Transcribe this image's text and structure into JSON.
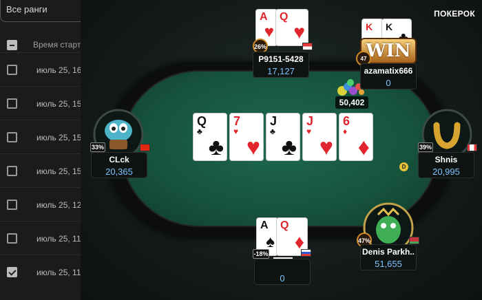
{
  "background_list": {
    "filter_value": "Все ранги",
    "header_label": "Время старт",
    "rows": [
      {
        "text": "июль 25, 16",
        "checked": false
      },
      {
        "text": "июль 25, 15",
        "checked": false
      },
      {
        "text": "июль 25, 15",
        "checked": false
      },
      {
        "text": "июль 25, 15",
        "checked": false
      },
      {
        "text": "июль 25, 12",
        "checked": false
      },
      {
        "text": "июль 25, 11",
        "checked": false
      },
      {
        "text": "июль 25, 11",
        "checked": true
      }
    ]
  },
  "brand": "ПОКЕРОК",
  "pot": "50,402",
  "board": [
    {
      "rank": "Q",
      "suit": "♣",
      "color": "black"
    },
    {
      "rank": "7",
      "suit": "♥",
      "color": "red"
    },
    {
      "rank": "J",
      "suit": "♣",
      "color": "black"
    },
    {
      "rank": "J",
      "suit": "♥",
      "color": "red"
    },
    {
      "rank": "6",
      "suit": "♦",
      "color": "red"
    }
  ],
  "players": {
    "top_center": {
      "name": "P9151-5428",
      "stack": "17,127",
      "equity": "26%",
      "cards": [
        {
          "rank": "A",
          "suit": "♥"
        },
        {
          "rank": "Q",
          "suit": "♥"
        }
      ]
    },
    "top_right": {
      "name": "azamatix666",
      "stack": "0",
      "equity": "47",
      "badge": "WIN",
      "cards": [
        {
          "rank": "K",
          "suit": "♥"
        },
        {
          "rank": "K",
          "suit": "♣"
        }
      ]
    },
    "left": {
      "name": "CLck",
      "stack": "20,365",
      "equity": "33%"
    },
    "right": {
      "name": "Shnis",
      "stack": "20,995",
      "equity": "39%"
    },
    "bottom_center": {
      "name": "",
      "stack": "0",
      "equity": "-18%",
      "cards": [
        {
          "rank": "A",
          "suit": "♠"
        },
        {
          "rank": "Q",
          "suit": "♦"
        }
      ]
    },
    "bottom_right": {
      "name": "Denis Parkh..",
      "stack": "51,655",
      "equity": "47%"
    }
  },
  "dealer_button": "D"
}
